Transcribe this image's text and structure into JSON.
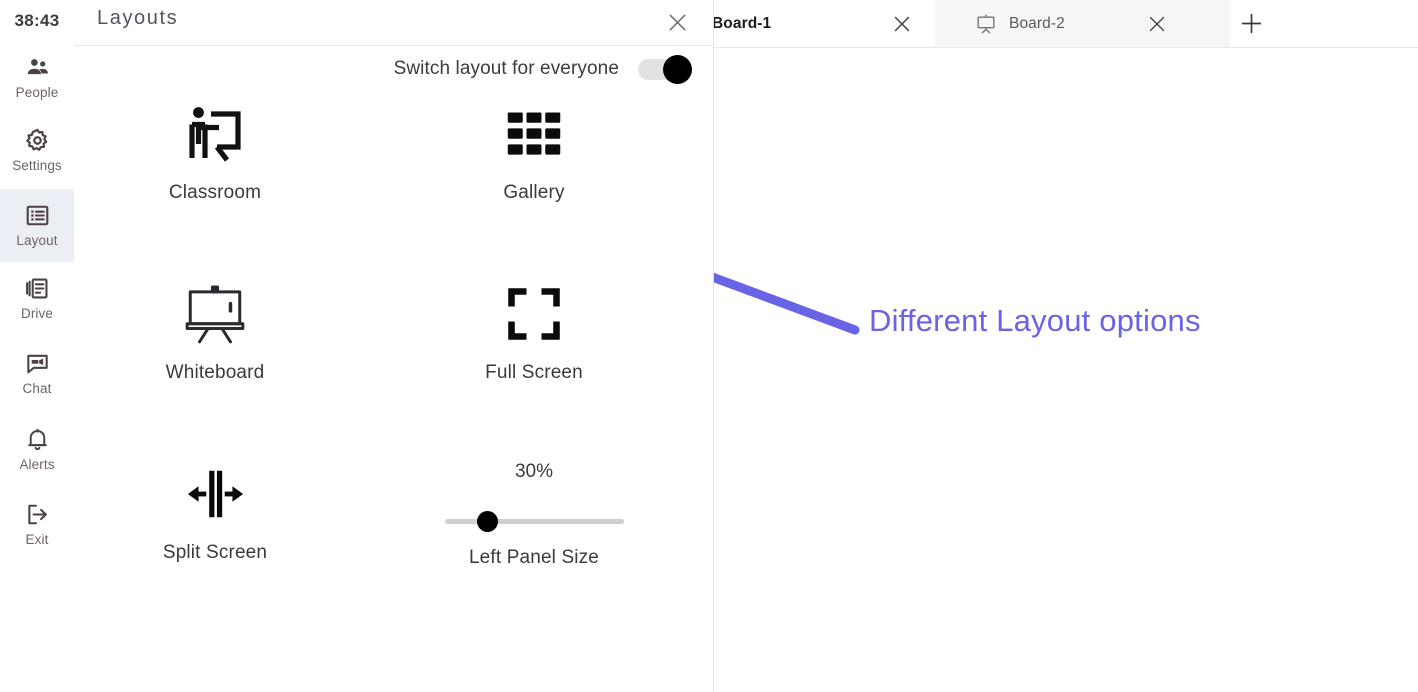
{
  "tabbar": {
    "tabs": [
      {
        "label": "Board-1",
        "active": true,
        "icon": "whiteboard-icon",
        "close_icon": "close-icon"
      },
      {
        "label": "Board-2",
        "active": false,
        "icon": "whiteboard-icon",
        "close_icon": "close-icon"
      }
    ],
    "add_tab_icon": "plus-icon"
  },
  "rail": {
    "clock": "38:43",
    "items": [
      {
        "label": "People",
        "icon": "people-icon",
        "selected": false
      },
      {
        "label": "Settings",
        "icon": "gear-icon",
        "selected": false
      },
      {
        "label": "Layout",
        "icon": "layout-icon",
        "selected": true
      },
      {
        "label": "Drive",
        "icon": "drive-icon",
        "selected": false
      },
      {
        "label": "Chat",
        "icon": "chat-icon",
        "selected": false
      },
      {
        "label": "Alerts",
        "icon": "bell-icon",
        "selected": false
      },
      {
        "label": "Exit",
        "icon": "exit-icon",
        "selected": false
      }
    ]
  },
  "modal": {
    "title": "Layouts",
    "close_icon": "close-icon",
    "toggle": {
      "label": "Switch layout for everyone",
      "state": "on"
    },
    "options": [
      {
        "label": "Classroom",
        "icon": "classroom-icon"
      },
      {
        "label": "Gallery",
        "icon": "grid-icon"
      },
      {
        "label": "Whiteboard",
        "icon": "easel-icon"
      },
      {
        "label": "Full Screen",
        "icon": "fullscreen-icon"
      },
      {
        "label": "Split Screen",
        "icon": "split-screen-icon"
      }
    ],
    "slider": {
      "label": "Left Panel Size",
      "value_text": "30%",
      "value": 30,
      "min": 0,
      "max": 100,
      "knob_position_percent": 24
    }
  },
  "annotation": {
    "text": "Different Layout options",
    "color": "#6a63e6",
    "arrow_icon": "arrow-pointer-icon"
  },
  "colors": {
    "accent_purple": "#6a63e6",
    "rail_selected_bg": "#eceef5",
    "toggle_track": "#e2e2e4",
    "toggle_knob": "#000000",
    "slider_track": "#cfcfcf",
    "inactive_tab_bg": "#f6f6f7"
  }
}
